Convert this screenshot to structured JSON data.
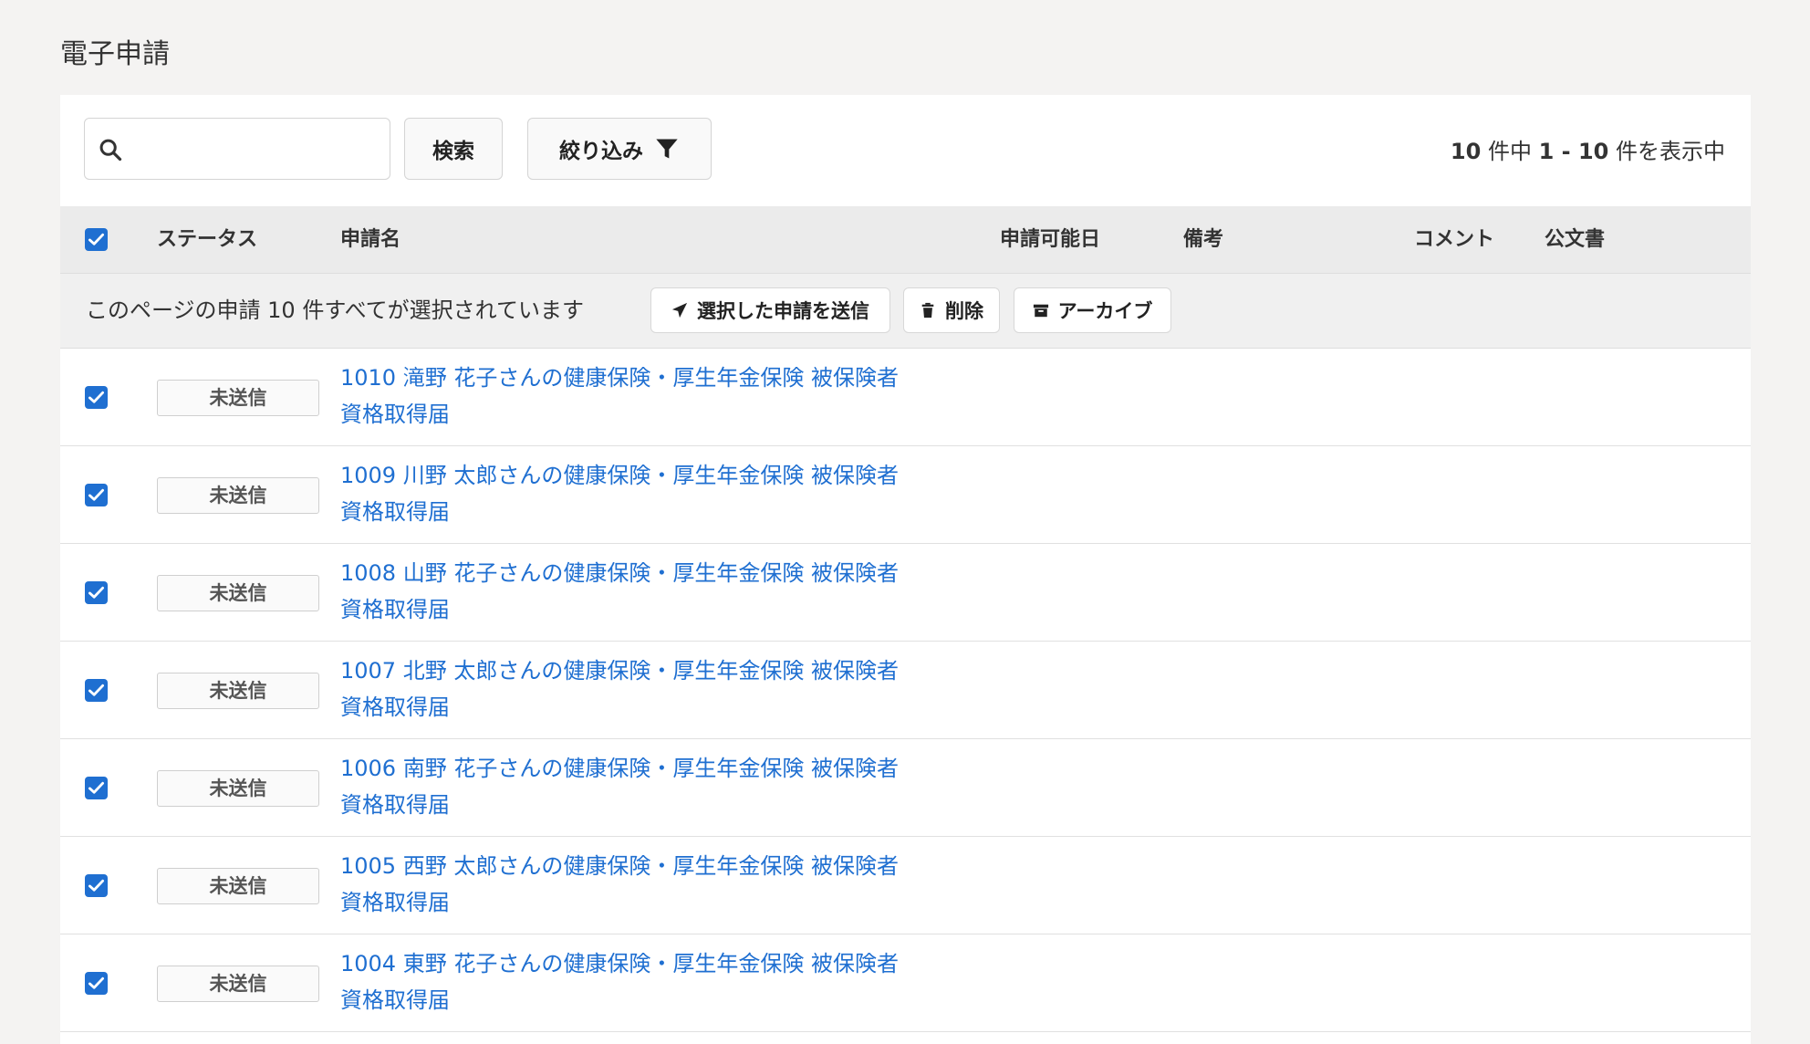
{
  "page": {
    "title": "電子申請"
  },
  "toolbar": {
    "search_placeholder": "",
    "search_button": "検索",
    "filter_button": "絞り込み",
    "count": {
      "total": "10",
      "mid1": " 件中 ",
      "range": "1 - 10",
      "mid2": " 件を表示中"
    }
  },
  "table": {
    "headers": {
      "status": "ステータス",
      "name": "申請名",
      "available_date": "申請可能日",
      "notes": "備考",
      "comment": "コメント",
      "official_doc": "公文書"
    },
    "bulk": {
      "message": "このページの申請 10 件すべてが選択されています",
      "send_button": "選択した申請を送信",
      "delete_button": "削除",
      "archive_button": "アーカイブ"
    },
    "rows": [
      {
        "checked": true,
        "status": "未送信",
        "title_line1": "1010 滝野 花子さんの健康保険・厚生年金保険 被保険者",
        "title_line2": "資格取得届"
      },
      {
        "checked": true,
        "status": "未送信",
        "title_line1": "1009 川野 太郎さんの健康保険・厚生年金保険 被保険者",
        "title_line2": "資格取得届"
      },
      {
        "checked": true,
        "status": "未送信",
        "title_line1": "1008 山野 花子さんの健康保険・厚生年金保険 被保険者",
        "title_line2": "資格取得届"
      },
      {
        "checked": true,
        "status": "未送信",
        "title_line1": "1007 北野 太郎さんの健康保険・厚生年金保険 被保険者",
        "title_line2": "資格取得届"
      },
      {
        "checked": true,
        "status": "未送信",
        "title_line1": "1006 南野 花子さんの健康保険・厚生年金保険 被保険者",
        "title_line2": "資格取得届"
      },
      {
        "checked": true,
        "status": "未送信",
        "title_line1": "1005 西野 太郎さんの健康保険・厚生年金保険 被保険者",
        "title_line2": "資格取得届"
      },
      {
        "checked": true,
        "status": "未送信",
        "title_line1": "1004 東野 花子さんの健康保険・厚生年金保険 被保険者",
        "title_line2": "資格取得届"
      }
    ]
  },
  "colors": {
    "accent": "#1f6fd1",
    "header_bg": "#ebebeb",
    "page_bg": "#f4f3f2"
  },
  "icons": {
    "search": "search-icon",
    "filter": "filter-icon",
    "send": "paper-plane-icon",
    "delete": "trash-icon",
    "archive": "archive-box-icon",
    "checkbox": "checkbox-checked-icon"
  }
}
